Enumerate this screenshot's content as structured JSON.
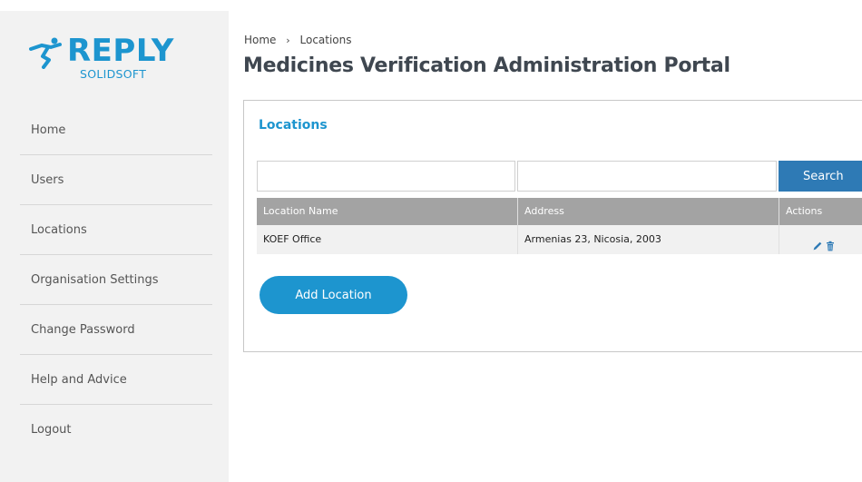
{
  "brand": {
    "name": "REPLY",
    "sub": "SOLIDSOFT",
    "color": "#1d95cf"
  },
  "sidebar": {
    "items": [
      {
        "label": "Home"
      },
      {
        "label": "Users"
      },
      {
        "label": "Locations"
      },
      {
        "label": "Organisation Settings"
      },
      {
        "label": "Change Password"
      },
      {
        "label": "Help and Advice"
      },
      {
        "label": "Logout"
      }
    ]
  },
  "breadcrumb": {
    "home": "Home",
    "separator": "›",
    "current": "Locations"
  },
  "page": {
    "title": "Medicines Verification Administration Portal"
  },
  "panel": {
    "title": "Locations",
    "search": {
      "name_value": "",
      "address_value": "",
      "button_label": "Search"
    },
    "table": {
      "columns": [
        "Location Name",
        "Address",
        "Actions"
      ],
      "rows": [
        {
          "name": "KOEF Office",
          "address": "Armenias 23, Nicosia, 2003",
          "actions": [
            "edit-icon",
            "delete-icon"
          ]
        }
      ]
    },
    "add_button_label": "Add Location"
  },
  "colors": {
    "accent": "#1d95cf",
    "search_button": "#2e7ab5",
    "table_header": "#a3a3a3",
    "sidebar_bg": "#f2f2f2"
  }
}
